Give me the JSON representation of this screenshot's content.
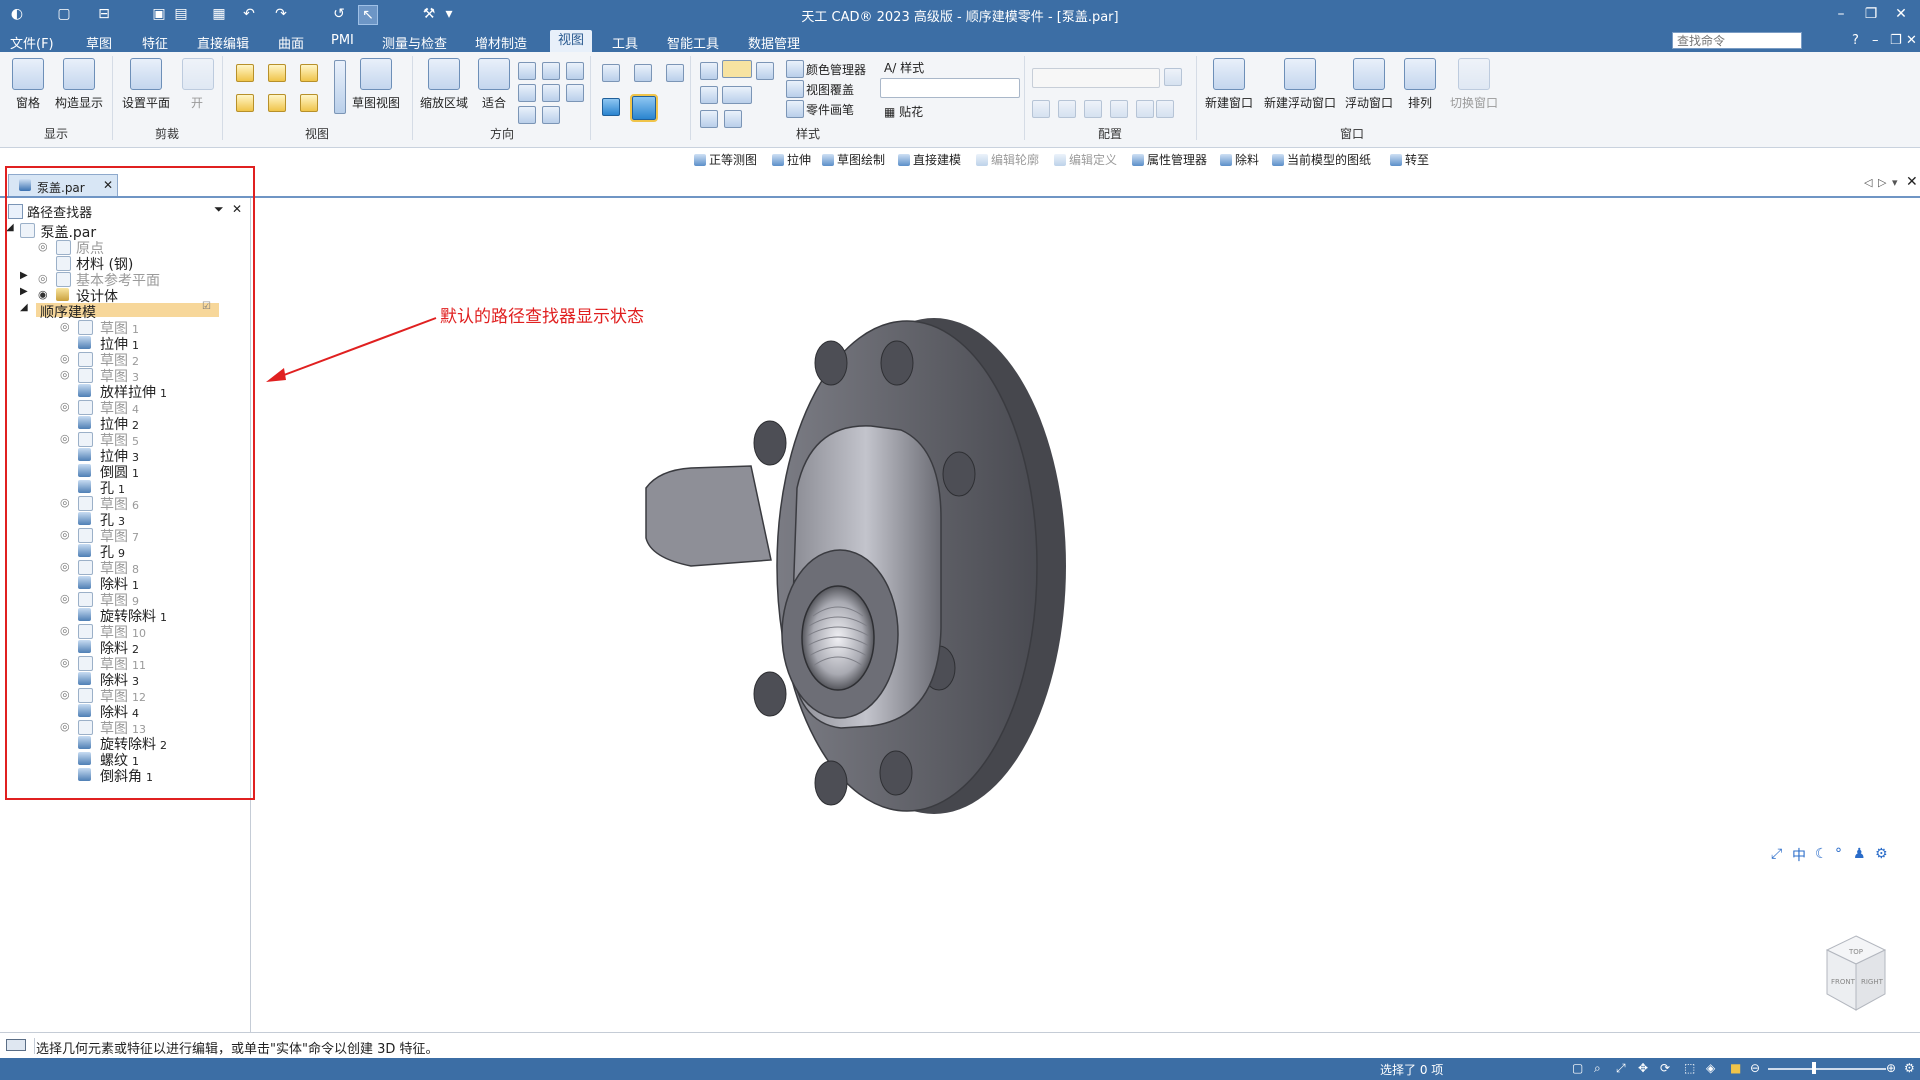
{
  "titlebar": {
    "title": "天工 CAD® 2023 高级版 - 顺序建模零件 - [泵盖.par]",
    "accent": "#3c6ea5"
  },
  "menu": {
    "items": [
      "文件(F)",
      "草图",
      "特征",
      "直接编辑",
      "曲面",
      "PMI",
      "测量与检查",
      "增材制造",
      "视图",
      "工具",
      "智能工具",
      "数据管理"
    ],
    "active": "视图",
    "search_placeholder": "查找命令"
  },
  "ribbon": {
    "display": {
      "pane": "窗格",
      "construction": "构造显示",
      "group": "显示"
    },
    "clip": {
      "set_plane": "设置平面",
      "open": "开",
      "group": "剪裁"
    },
    "view": {
      "sketch_view": "草图视图",
      "group": "视图"
    },
    "orient": {
      "zoom_area": "缩放区域",
      "fit": "适合",
      "group": "方向"
    },
    "style": {
      "color_manager": "颜色管理器",
      "view_overlay": "视图覆盖",
      "part_painter": "零件画笔",
      "style": "样式",
      "decal": "贴花",
      "group": "样式"
    },
    "config": {
      "group": "配置"
    },
    "window": {
      "new_window": "新建窗口",
      "new_float": "新建浮动窗口",
      "float": "浮动窗口",
      "arrange": "排列",
      "switch": "切换窗口",
      "group": "窗口"
    }
  },
  "cmdbar": {
    "items": [
      {
        "label": "正等测图",
        "enabled": true
      },
      {
        "label": "拉伸",
        "enabled": true
      },
      {
        "label": "草图绘制",
        "enabled": true
      },
      {
        "label": "直接建模",
        "enabled": true
      },
      {
        "label": "编辑轮廓",
        "enabled": false
      },
      {
        "label": "编辑定义",
        "enabled": false
      },
      {
        "label": "属性管理器",
        "enabled": true
      },
      {
        "label": "除料",
        "enabled": true
      },
      {
        "label": "当前模型的图纸",
        "enabled": true
      },
      {
        "label": "转至",
        "enabled": true
      }
    ]
  },
  "doc_tab": {
    "label": "泵盖.par"
  },
  "pathfinder": {
    "title": "路径查找器",
    "root": "泵盖.par",
    "origin": "原点",
    "material": "材料 (钢)",
    "ref_planes": "基本参考平面",
    "design_body": "设计体",
    "ordered": "顺序建模",
    "features": [
      {
        "label": "草图",
        "num": "1",
        "sketch": true
      },
      {
        "label": "拉伸",
        "num": "1",
        "sketch": false
      },
      {
        "label": "草图",
        "num": "2",
        "sketch": true
      },
      {
        "label": "草图",
        "num": "3",
        "sketch": true
      },
      {
        "label": "放样拉伸",
        "num": "1",
        "sketch": false
      },
      {
        "label": "草图",
        "num": "4",
        "sketch": true
      },
      {
        "label": "拉伸",
        "num": "2",
        "sketch": false
      },
      {
        "label": "草图",
        "num": "5",
        "sketch": true
      },
      {
        "label": "拉伸",
        "num": "3",
        "sketch": false
      },
      {
        "label": "倒圆",
        "num": "1",
        "sketch": false
      },
      {
        "label": "孔",
        "num": "1",
        "sketch": false
      },
      {
        "label": "草图",
        "num": "6",
        "sketch": true
      },
      {
        "label": "孔",
        "num": "3",
        "sketch": false
      },
      {
        "label": "草图",
        "num": "7",
        "sketch": true
      },
      {
        "label": "孔",
        "num": "9",
        "sketch": false
      },
      {
        "label": "草图",
        "num": "8",
        "sketch": true
      },
      {
        "label": "除料",
        "num": "1",
        "sketch": false
      },
      {
        "label": "草图",
        "num": "9",
        "sketch": true
      },
      {
        "label": "旋转除料",
        "num": "1",
        "sketch": false
      },
      {
        "label": "草图",
        "num": "10",
        "sketch": true
      },
      {
        "label": "除料",
        "num": "2",
        "sketch": false
      },
      {
        "label": "草图",
        "num": "11",
        "sketch": true
      },
      {
        "label": "除料",
        "num": "3",
        "sketch": false
      },
      {
        "label": "草图",
        "num": "12",
        "sketch": true
      },
      {
        "label": "除料",
        "num": "4",
        "sketch": false
      },
      {
        "label": "草图",
        "num": "13",
        "sketch": true
      },
      {
        "label": "旋转除料",
        "num": "2",
        "sketch": false
      },
      {
        "label": "螺纹",
        "num": "1",
        "sketch": false
      },
      {
        "label": "倒斜角",
        "num": "1",
        "sketch": false
      }
    ]
  },
  "annotation": {
    "text": "默认的路径查找器显示状态",
    "color": "#e02020"
  },
  "viewtools": {
    "center": "中"
  },
  "statusbar": {
    "prompt": "选择几何元素或特征以进行编辑，或单击\"实体\"命令以创建 3D 特征。",
    "selection": "选择了 0 项"
  },
  "viewcube": {
    "top": "TOP",
    "front": "FRONT",
    "right": "RIGHT"
  }
}
